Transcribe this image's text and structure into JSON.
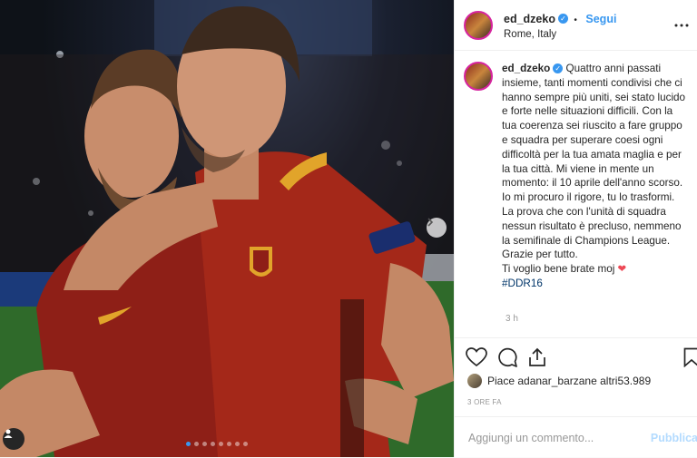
{
  "post": {
    "image_alt": "",
    "carousel": {
      "count": 8,
      "active_index": 0
    }
  },
  "header": {
    "username": "ed_dzeko",
    "verified_mark": "✓",
    "separator": "•",
    "follow_label": "Segui",
    "location": "Rome, Italy"
  },
  "caption": {
    "username": "ed_dzeko",
    "verified_mark": "✓",
    "lines": [
      " Quattro anni passati insieme, tanti momenti condivisi che ci hanno sempre più uniti, sei stato lucido e forte nelle situazioni difficili. Con la tua coerenza sei riuscito a fare gruppo e squadra per superare coesi ogni difficoltà per la tua amata maglia e per la tua città. Mi viene in mente un momento: il 10 aprile dell'anno scorso. Io mi procuro il rigore, tu lo trasformi. La prova che con l'unità di squadra nessun risultato è precluso, nemmeno la semifinale di Champions League."
    ],
    "thanks": "Grazie per tutto.",
    "love": "Ti voglio bene brate moj ",
    "heart": "❤",
    "hashtag": "#DDR16",
    "time": "3 h"
  },
  "actions": {
    "like_icon": "heart-outline-icon",
    "comment_icon": "comment-icon",
    "share_icon": "share-icon",
    "save_icon": "bookmark-icon"
  },
  "likes": {
    "text_prefix": "Piace a ",
    "user": "danar_barzan",
    "text_suffix": " e altri ",
    "count": "53.989"
  },
  "time_ago": "3 ORE FA",
  "comment": {
    "placeholder": "Aggiungi un commento...",
    "publish_label": "Pubblica"
  },
  "colors": {
    "accent": "#3897f0",
    "heart": "#ed4956",
    "jersey": "#9b2319"
  }
}
